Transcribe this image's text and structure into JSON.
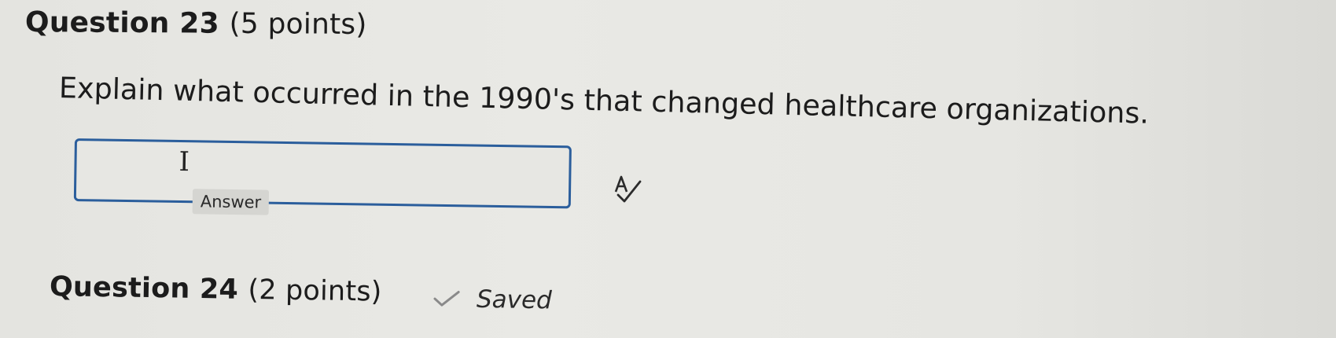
{
  "question23": {
    "title": "Question 23",
    "points": "(5 points)",
    "prompt": "Explain what occurred in the 1990's that changed healthcare organizations.",
    "answer": {
      "value": "",
      "label": "Answer"
    }
  },
  "question24": {
    "title": "Question 24",
    "points": "(2 points)",
    "status": "Saved"
  },
  "icons": {
    "text_cursor": "text-cursor-icon",
    "spellcheck": "spellcheck-icon",
    "saved_check": "checkmark-icon"
  },
  "colors": {
    "answer_border": "#2b5e9c",
    "saved_check": "#8a8a8a"
  }
}
